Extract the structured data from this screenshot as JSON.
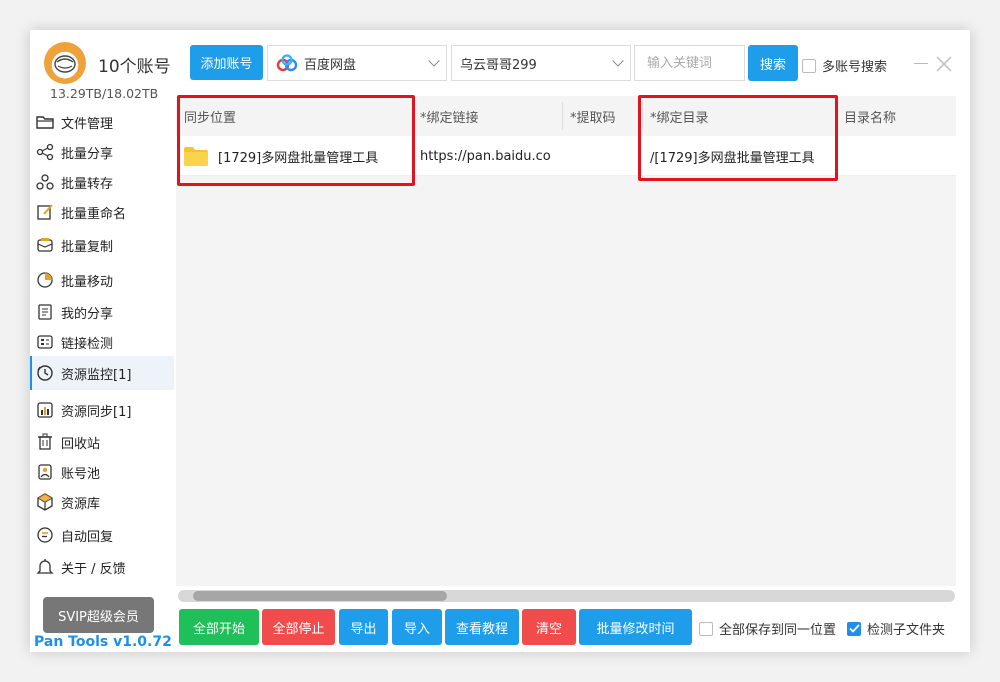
{
  "header": {
    "account_count": "10个账号",
    "storage": "13.29TB/18.02TB",
    "add_account_label": "添加账号",
    "disk_select_value": "百度网盘",
    "user_select_value": "乌云哥哥299",
    "keyword_placeholder": "输入关键词",
    "search_label": "搜索",
    "multi_account_search_label": "多账号搜索"
  },
  "sidebar": {
    "items": [
      {
        "label": "文件管理",
        "icon": "folder-icon"
      },
      {
        "label": "批量分享",
        "icon": "share-icon"
      },
      {
        "label": "批量转存",
        "icon": "transfer-icon"
      },
      {
        "label": "批量重命名",
        "icon": "rename-icon"
      },
      {
        "label": "批量复制",
        "icon": "copy-icon"
      },
      {
        "label": "批量移动",
        "icon": "move-icon"
      },
      {
        "label": "我的分享",
        "icon": "my-share-icon"
      },
      {
        "label": "链接检测",
        "icon": "link-check-icon"
      },
      {
        "label": "资源监控[1]",
        "icon": "monitor-icon"
      },
      {
        "label": "资源同步[1]",
        "icon": "sync-chart-icon"
      },
      {
        "label": "回收站",
        "icon": "trash-icon"
      },
      {
        "label": "账号池",
        "icon": "account-pool-icon"
      },
      {
        "label": "资源库",
        "icon": "resource-box-icon"
      },
      {
        "label": "自动回复",
        "icon": "auto-reply-icon"
      },
      {
        "label": "关于 / 反馈",
        "icon": "bell-icon"
      }
    ],
    "active_index": 8,
    "svip_label": "SVIP超级会员",
    "version": "Pan Tools v1.0.72"
  },
  "table": {
    "columns": [
      "同步位置",
      "*绑定链接",
      "*提取码",
      "*绑定目录",
      "目录名称"
    ],
    "rows": [
      {
        "sync_location": "[1729]多网盘批量管理工具",
        "bind_link": "https://pan.baidu.co",
        "extract_code": "",
        "bind_dir": "/[1729]多网盘批量管理工具",
        "dir_name": ""
      }
    ]
  },
  "footer": {
    "start_all": "全部开始",
    "stop_all": "全部停止",
    "export": "导出",
    "import": "导入",
    "tutorial": "查看教程",
    "clear": "清空",
    "batch_edit_time": "批量修改时间",
    "save_same_location_label": "全部保存到同一位置",
    "save_same_location_checked": false,
    "detect_subfolder_label": "检测子文件夹",
    "detect_subfolder_checked": true
  },
  "colors": {
    "accent": "#1e9dea",
    "green": "#1fbf5a",
    "red": "#f04c4c",
    "highlight": "#e0141e",
    "version_text": "#1e90e8"
  }
}
